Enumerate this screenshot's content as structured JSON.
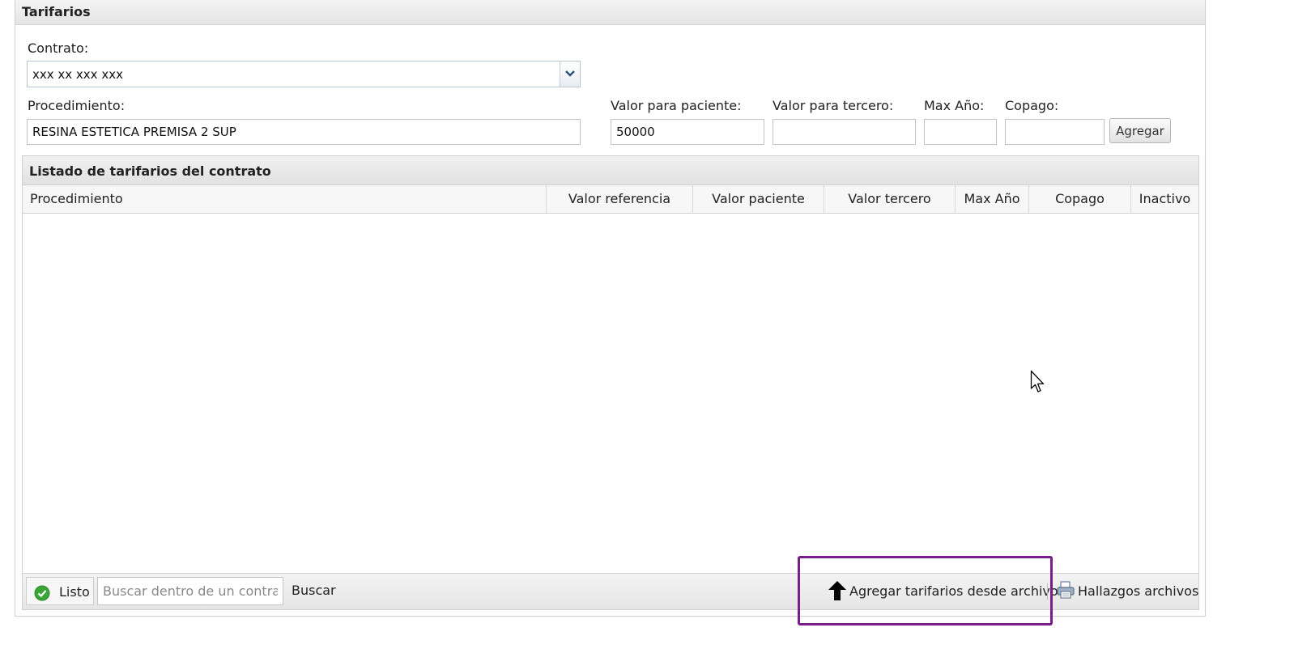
{
  "panel": {
    "title": "Tarifarios"
  },
  "form": {
    "contrato_label": "Contrato:",
    "contrato_value": "xxx xx xxx xxx",
    "procedimiento_label": "Procedimiento:",
    "procedimiento_value": "RESINA ESTETICA PREMISA 2 SUP",
    "valor_paciente_label": "Valor para paciente:",
    "valor_paciente_value": "50000",
    "valor_tercero_label": "Valor para tercero:",
    "valor_tercero_value": "",
    "max_anio_label": "Max Año:",
    "max_anio_value": "",
    "copago_label": "Copago:",
    "copago_value": "",
    "agregar_label": "Agregar"
  },
  "grid": {
    "title": "Listado de tarifarios del contrato",
    "columns": [
      "Procedimiento",
      "Valor referencia",
      "Valor paciente",
      "Valor tercero",
      "Max Año",
      "Copago",
      "Inactivo"
    ]
  },
  "toolbar": {
    "status": "Listo",
    "search_placeholder": "Buscar dentro de un contrato",
    "search_button": "Buscar",
    "upload_button": "Agregar tarifarios desde archivo",
    "findings_button": "Hallazgos archivos"
  },
  "icons": {
    "dropdown": "chevron-down-icon",
    "status": "check-circle-icon",
    "upload": "arrow-up-icon",
    "findings": "printer-icon",
    "cursor": "mouse-pointer-icon"
  },
  "colors": {
    "highlight": "#7a1c8a",
    "status_ok": "#3aa63a"
  }
}
